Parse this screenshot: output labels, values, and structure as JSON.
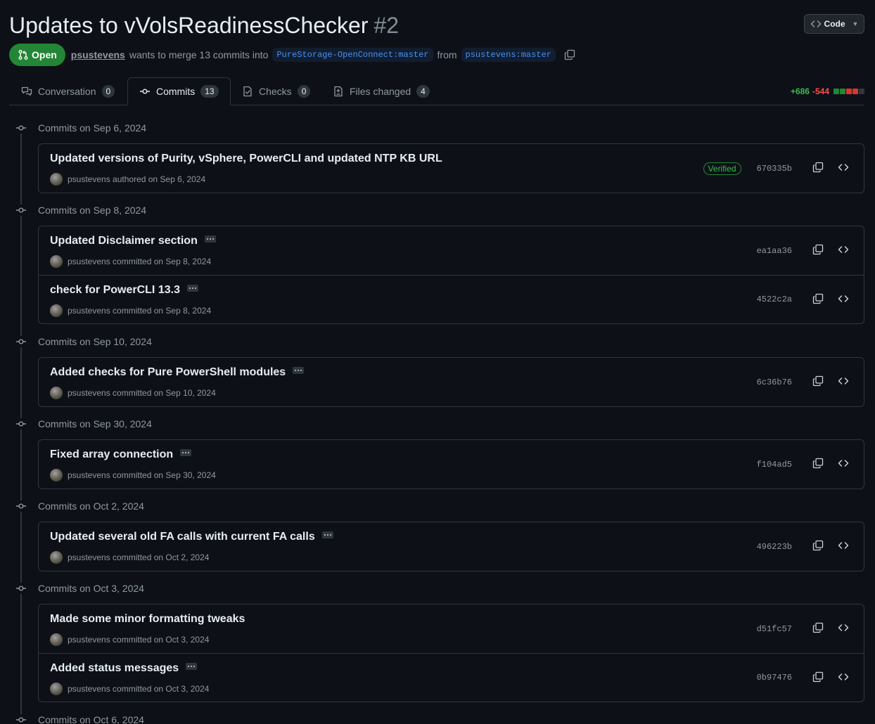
{
  "header": {
    "title": "Updates to vVolsReadinessChecker",
    "number": "#2",
    "code_button": "Code"
  },
  "meta": {
    "state": "Open",
    "author": "psustevens",
    "text_mid": "wants to merge 13 commits into",
    "base_branch": "PureStorage-OpenConnect:master",
    "text_from": "from",
    "head_branch": "psustevens:master"
  },
  "tabs": [
    {
      "label": "Conversation",
      "count": "0",
      "icon": "comment-discussion-icon"
    },
    {
      "label": "Commits",
      "count": "13",
      "icon": "git-commit-icon"
    },
    {
      "label": "Checks",
      "count": "0",
      "icon": "checklist-icon"
    },
    {
      "label": "Files changed",
      "count": "4",
      "icon": "file-diff-icon"
    }
  ],
  "diffstat": {
    "additions": "+686",
    "deletions": "-544",
    "block_colors": [
      "#238636",
      "#238636",
      "#da3633",
      "#da3633",
      "#30363d"
    ]
  },
  "groups": [
    {
      "heading": "Commits on Sep 6, 2024",
      "commits": [
        {
          "message": "Updated versions of Purity, vSphere, PowerCLI and updated NTP KB URL",
          "byline": "psustevens authored on Sep 6, 2024",
          "sha": "670335b",
          "verified": "Verified",
          "has_more": false
        }
      ]
    },
    {
      "heading": "Commits on Sep 8, 2024",
      "commits": [
        {
          "message": "Updated Disclaimer section",
          "byline": "psustevens committed on Sep 8, 2024",
          "sha": "ea1aa36",
          "verified": "",
          "has_more": true
        },
        {
          "message": "check for PowerCLI 13.3",
          "byline": "psustevens committed on Sep 8, 2024",
          "sha": "4522c2a",
          "verified": "",
          "has_more": true
        }
      ]
    },
    {
      "heading": "Commits on Sep 10, 2024",
      "commits": [
        {
          "message": "Added checks for Pure PowerShell modules",
          "byline": "psustevens committed on Sep 10, 2024",
          "sha": "6c36b76",
          "verified": "",
          "has_more": true
        }
      ]
    },
    {
      "heading": "Commits on Sep 30, 2024",
      "commits": [
        {
          "message": "Fixed array connection",
          "byline": "psustevens committed on Sep 30, 2024",
          "sha": "f104ad5",
          "verified": "",
          "has_more": true
        }
      ]
    },
    {
      "heading": "Commits on Oct 2, 2024",
      "commits": [
        {
          "message": "Updated several old FA calls with current FA calls",
          "byline": "psustevens committed on Oct 2, 2024",
          "sha": "496223b",
          "verified": "",
          "has_more": true
        }
      ]
    },
    {
      "heading": "Commits on Oct 3, 2024",
      "commits": [
        {
          "message": "Made some minor formatting tweaks",
          "byline": "psustevens committed on Oct 3, 2024",
          "sha": "d51fc57",
          "verified": "",
          "has_more": false
        },
        {
          "message": "Added status messages",
          "byline": "psustevens committed on Oct 3, 2024",
          "sha": "0b97476",
          "verified": "",
          "has_more": true
        }
      ]
    },
    {
      "heading": "Commits on Oct 6, 2024",
      "commits": []
    }
  ]
}
